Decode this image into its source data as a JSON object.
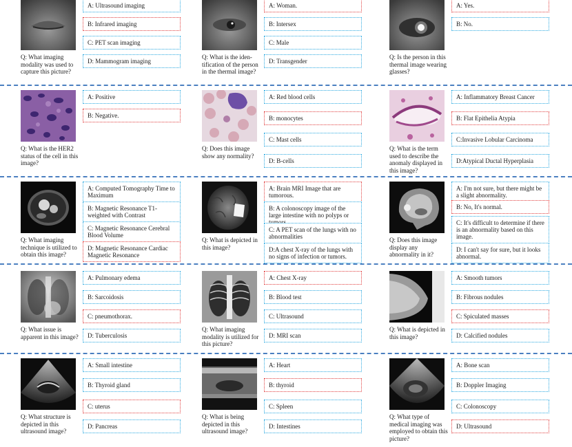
{
  "rows": [
    {
      "cells": [
        {
          "question": "Q: What imaging modality was used to capture this picture?",
          "image": "thermal-eye-closed",
          "options": [
            {
              "text": "A: Ultrasound imaging",
              "correct": false
            },
            {
              "text": "B: Infrared imaging",
              "correct": true
            },
            {
              "text": "C: PET scan imaging",
              "correct": false
            },
            {
              "text": "D: Mammogram imaging",
              "correct": false
            }
          ]
        },
        {
          "question": "Q: What is the iden-tification of the person in the thermal image?",
          "image": "thermal-eye-open",
          "options": [
            {
              "text": "A: Woman.",
              "correct": true
            },
            {
              "text": "B: Intersex",
              "correct": false
            },
            {
              "text": "C: Male",
              "correct": false
            },
            {
              "text": "D: Transgender",
              "correct": false
            }
          ]
        },
        {
          "question": "Q: Is the person in this thermal image wearing glasses?",
          "image": "thermal-glasses",
          "options": [
            {
              "text": "A: Yes.",
              "correct": true
            },
            {
              "text": "B: No.",
              "correct": false
            }
          ]
        }
      ]
    },
    {
      "cells": [
        {
          "question": "Q: What is the HER2 status of the cell in this image?",
          "image": "histology-purple",
          "options": [
            {
              "text": "A: Positive",
              "correct": false
            },
            {
              "text": "B: Negative.",
              "correct": true
            }
          ]
        },
        {
          "question": "Q: Does this image show any normality?",
          "image": "blood-smear",
          "options": [
            {
              "text": "A: Red blood cells",
              "correct": false
            },
            {
              "text": "B: monocytes",
              "correct": true
            },
            {
              "text": "C: Mast cells",
              "correct": false
            },
            {
              "text": "D: B-cells",
              "correct": false
            }
          ]
        },
        {
          "question": "Q: What is the term used to describe the anomaly displayed in this image?",
          "image": "histology-duct",
          "options": [
            {
              "text": "A: Inflammatory Breast Cancer",
              "correct": false
            },
            {
              "text": "B: Flat Epithelia Atypia",
              "correct": true
            },
            {
              "text": "C:Invasive Lobular Carcinoma",
              "correct": false
            },
            {
              "text": "D:Atypical Ductal Hyperplasia",
              "correct": false
            }
          ]
        }
      ]
    },
    {
      "cells": [
        {
          "question": "Q: What imaging technique is utilized to obtain this image?",
          "image": "cardiac-mri",
          "options": [
            {
              "text": "A: Computed Tomography Time to Maximum",
              "correct": false
            },
            {
              "text": "B: Magnetic Resonance T1-weighted with Contrast",
              "correct": false
            },
            {
              "text": "C: Magnetic Resonance Cerebral Blood Volume",
              "correct": false
            },
            {
              "text": "D: Magnetic Resonance Cardiac Magnetic Resonance",
              "correct": true
            }
          ]
        },
        {
          "question": "Q: What is depicted in this image?",
          "image": "brain-mri",
          "options": [
            {
              "text": "A: Brain MRI Image that are tumorous.",
              "correct": true
            },
            {
              "text": "B: A colonoscopy image of the large intestine with no polyps or tumors",
              "correct": false
            },
            {
              "text": "C: A PET scan of the lungs with no abnormalities",
              "correct": false
            },
            {
              "text": "D:A chest X-ray of the lungs with no signs of infection or tumors.",
              "correct": false
            }
          ]
        },
        {
          "question": "Q: Does this image display any abnormality in it?",
          "image": "brain-sagittal",
          "options": [
            {
              "text": "A: I'm not sure, but there might be a slight abnormality.",
              "correct": false
            },
            {
              "text": "B: No, It's normal.",
              "correct": true
            },
            {
              "text": "C: It's difficult to determine if there is an abnormality based on this image.",
              "correct": false
            },
            {
              "text": "D: I can't say for sure, but it looks abnormal.",
              "correct": false
            }
          ]
        }
      ]
    },
    {
      "cells": [
        {
          "question": "Q: What issue is apparent in this image?",
          "image": "chest-xray-1",
          "options": [
            {
              "text": "A: Pulmonary edema",
              "correct": false
            },
            {
              "text": "B: Sarcoidosis",
              "correct": false
            },
            {
              "text": "C: pneumothorax.",
              "correct": true
            },
            {
              "text": "D: Tuberculosis",
              "correct": false
            }
          ]
        },
        {
          "question": "Q: What imaging modality is utilized for this picture?",
          "image": "chest-xray-2",
          "options": [
            {
              "text": "A: Chest X-ray",
              "correct": true
            },
            {
              "text": "B: Blood test",
              "correct": false
            },
            {
              "text": "C: Ultrasound",
              "correct": false
            },
            {
              "text": "D: MRI scan",
              "correct": false
            }
          ]
        },
        {
          "question": "Q: What is depicted in this image?",
          "image": "mammogram",
          "options": [
            {
              "text": "A: Smooth tumors",
              "correct": false
            },
            {
              "text": "B: Fibrous nodules",
              "correct": false
            },
            {
              "text": "C: Spiculated masses",
              "correct": true
            },
            {
              "text": "D: Calcified nodules",
              "correct": false
            }
          ]
        }
      ]
    },
    {
      "cells": [
        {
          "question": "Q: What structure is depicted in this ultrasound image?",
          "image": "ultrasound-1",
          "options": [
            {
              "text": "A: Small intestine",
              "correct": false
            },
            {
              "text": "B: Thyroid gland",
              "correct": false
            },
            {
              "text": "C: uterus",
              "correct": true
            },
            {
              "text": "D: Pancreas",
              "correct": false
            }
          ]
        },
        {
          "question": "Q: What is being depicted in this ultrasound image?",
          "image": "ultrasound-2",
          "options": [
            {
              "text": "A: Heart",
              "correct": false
            },
            {
              "text": "B: thyroid",
              "correct": true
            },
            {
              "text": "C: Spleen",
              "correct": false
            },
            {
              "text": "D: Intestines",
              "correct": false
            }
          ]
        },
        {
          "question": "Q: What type of medical imaging was employed to obtain this picture?",
          "image": "ultrasound-3",
          "options": [
            {
              "text": "A: Bone scan",
              "correct": false
            },
            {
              "text": "B: Doppler Imaging",
              "correct": false
            },
            {
              "text": "C: Colonoscopy",
              "correct": false
            },
            {
              "text": "D: Ultrasound",
              "correct": true
            }
          ]
        }
      ]
    }
  ]
}
